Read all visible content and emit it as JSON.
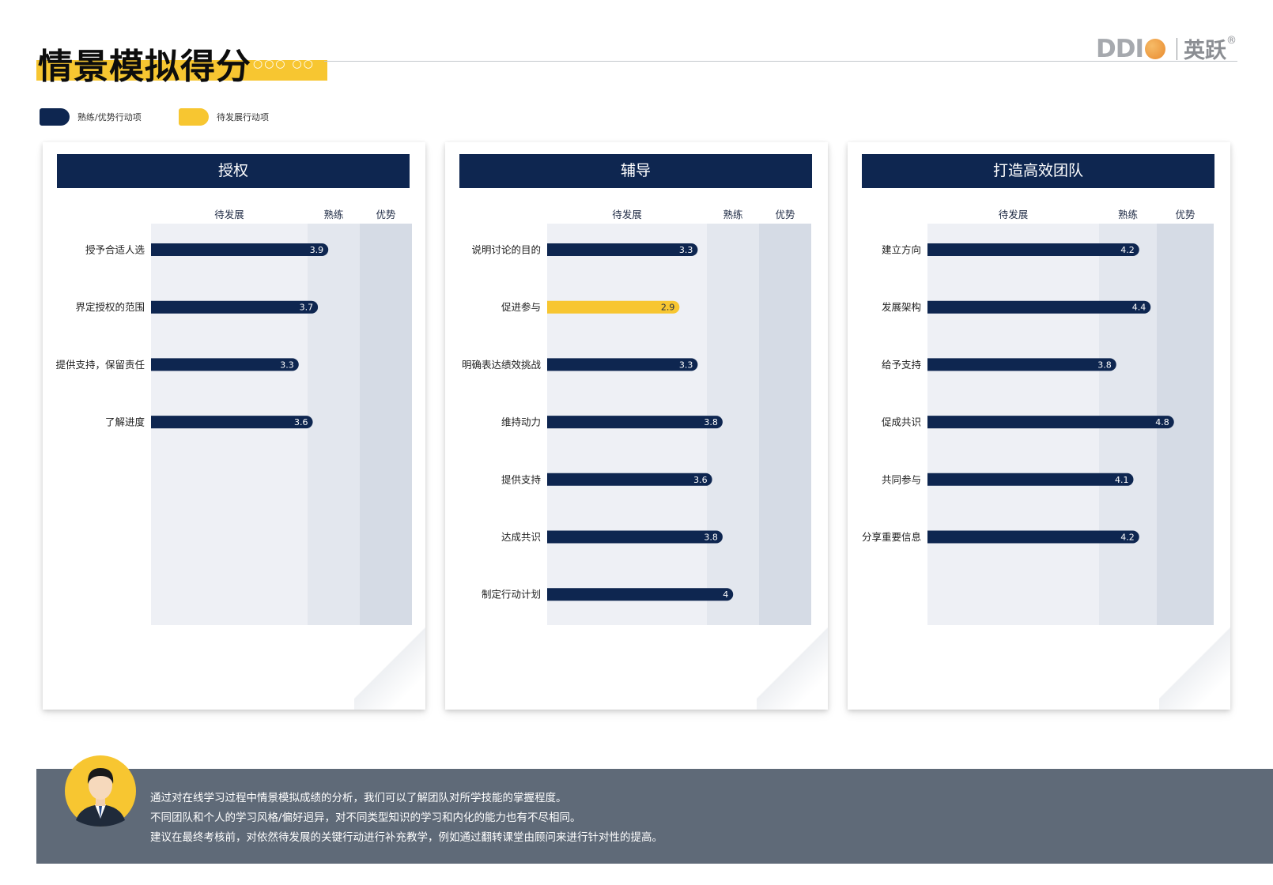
{
  "header": {
    "title": "情景模拟得分",
    "logo_text": "DDI",
    "logo_cn": "英跃",
    "logo_reg": "®"
  },
  "legend": [
    {
      "label": "熟练/优势行动项",
      "color": "#0e2650"
    },
    {
      "label": "待发展行动项",
      "color": "#f7c631"
    }
  ],
  "colors": {
    "navy": "#0e2650",
    "yellow": "#f7c631",
    "band_develop": "#eef0f5",
    "band_proficient": "#e3e7ee",
    "band_strength": "#d5dbe5",
    "footer_bg": "#5f6a78"
  },
  "chart_data": [
    {
      "type": "bar",
      "title": "授权",
      "bands": [
        "待发展",
        "熟练",
        "优势"
      ],
      "band_bounds": [
        0,
        3.5,
        4.5,
        5.5
      ],
      "categories": [
        "授予合适人选",
        "界定授权的范围",
        "提供支持，保留责任",
        "了解进度"
      ],
      "values": [
        3.9,
        3.7,
        3.3,
        3.6
      ],
      "status": [
        "proficient",
        "proficient",
        "proficient",
        "proficient"
      ]
    },
    {
      "type": "bar",
      "title": "辅导",
      "bands": [
        "待发展",
        "熟练",
        "优势"
      ],
      "band_bounds": [
        0,
        3.5,
        4.5,
        5.5
      ],
      "categories": [
        "说明讨论的目的",
        "促进参与",
        "明确表达绩效挑战",
        "维持动力",
        "提供支持",
        "达成共识",
        "制定行动计划"
      ],
      "values": [
        3.3,
        2.9,
        3.3,
        3.8,
        3.6,
        3.8,
        4
      ],
      "status": [
        "proficient",
        "develop",
        "proficient",
        "proficient",
        "proficient",
        "proficient",
        "proficient"
      ]
    },
    {
      "type": "bar",
      "title": "打造高效团队",
      "bands": [
        "待发展",
        "熟练",
        "优势"
      ],
      "band_bounds": [
        0,
        3.5,
        4.5,
        5.5
      ],
      "categories": [
        "建立方向",
        "发展架构",
        "给予支持",
        "促成共识",
        "共同参与",
        "分享重要信息"
      ],
      "values": [
        4.2,
        4.4,
        3.8,
        4.8,
        4.1,
        4.2
      ],
      "status": [
        "proficient",
        "proficient",
        "proficient",
        "proficient",
        "proficient",
        "proficient"
      ]
    }
  ],
  "footer": {
    "lines": [
      "通过对在线学习过程中情景模拟成绩的分析，我们可以了解团队对所学技能的掌握程度。",
      "不同团队和个人的学习风格/偏好迥异，对不同类型知识的学习和内化的能力也有不尽相同。",
      "建议在最终考核前，对依然待发展的关键行动进行补充教学，例如通过翻转课堂由顾问来进行针对性的提高。"
    ]
  }
}
